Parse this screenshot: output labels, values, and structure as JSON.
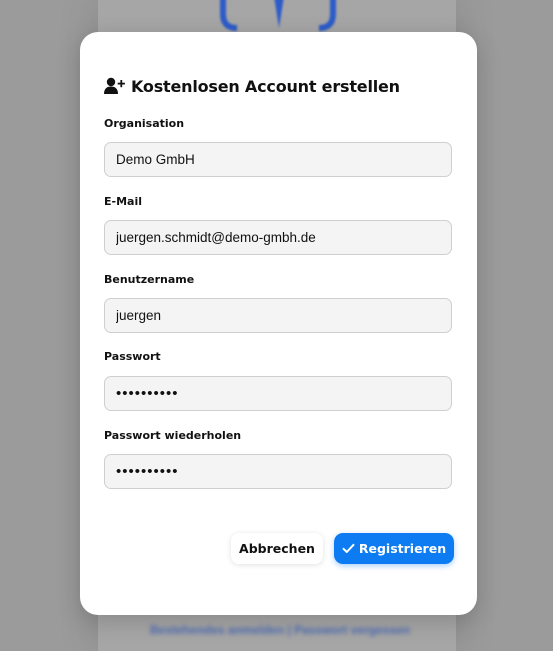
{
  "background": {
    "links_text": "Bestehendes anmelden | Passwort vergessen"
  },
  "modal": {
    "title": "Kostenlosen Account erstellen",
    "title_icon": "user-plus-icon",
    "fields": {
      "organisation": {
        "label": "Organisation",
        "value": "Demo GmbH"
      },
      "email": {
        "label": "E-Mail",
        "value": "juergen.schmidt@demo-gmbh.de"
      },
      "username": {
        "label": "Benutzername",
        "value": "juergen"
      },
      "password": {
        "label": "Passwort",
        "value": "••••••••••"
      },
      "password_repeat": {
        "label": "Passwort wiederholen",
        "value": "••••••••••"
      }
    },
    "buttons": {
      "cancel": "Abbrechen",
      "submit": "Registrieren",
      "submit_icon": "check-icon"
    }
  },
  "colors": {
    "accent": "#0d7cf2",
    "overlay": "#9b9b9b",
    "input_bg": "#f4f4f4"
  }
}
